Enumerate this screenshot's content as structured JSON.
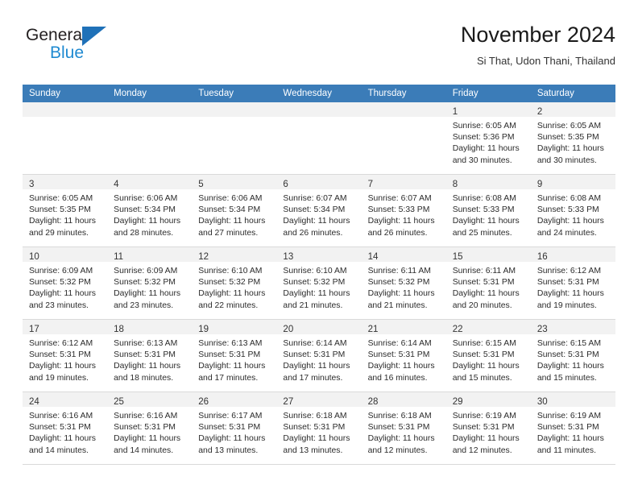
{
  "brand": {
    "name_top": "General",
    "name_bottom": "Blue",
    "accent_color": "#1f8ad1",
    "triangle_color": "#1f71b8"
  },
  "header": {
    "title": "November 2024",
    "subtitle": "Si That, Udon Thani, Thailand"
  },
  "calendar": {
    "header_bg": "#3b7cb8",
    "daynum_bg": "#f2f2f2",
    "weekdays": [
      "Sunday",
      "Monday",
      "Tuesday",
      "Wednesday",
      "Thursday",
      "Friday",
      "Saturday"
    ],
    "labels": {
      "sunrise": "Sunrise:",
      "sunset": "Sunset:",
      "daylight": "Daylight:"
    },
    "weeks": [
      [
        {
          "empty": true
        },
        {
          "empty": true
        },
        {
          "empty": true
        },
        {
          "empty": true
        },
        {
          "empty": true
        },
        {
          "day": "1",
          "sunrise": "Sunrise: 6:05 AM",
          "sunset": "Sunset: 5:36 PM",
          "daylight_1": "Daylight: 11 hours",
          "daylight_2": "and 30 minutes."
        },
        {
          "day": "2",
          "sunrise": "Sunrise: 6:05 AM",
          "sunset": "Sunset: 5:35 PM",
          "daylight_1": "Daylight: 11 hours",
          "daylight_2": "and 30 minutes."
        }
      ],
      [
        {
          "day": "3",
          "sunrise": "Sunrise: 6:05 AM",
          "sunset": "Sunset: 5:35 PM",
          "daylight_1": "Daylight: 11 hours",
          "daylight_2": "and 29 minutes."
        },
        {
          "day": "4",
          "sunrise": "Sunrise: 6:06 AM",
          "sunset": "Sunset: 5:34 PM",
          "daylight_1": "Daylight: 11 hours",
          "daylight_2": "and 28 minutes."
        },
        {
          "day": "5",
          "sunrise": "Sunrise: 6:06 AM",
          "sunset": "Sunset: 5:34 PM",
          "daylight_1": "Daylight: 11 hours",
          "daylight_2": "and 27 minutes."
        },
        {
          "day": "6",
          "sunrise": "Sunrise: 6:07 AM",
          "sunset": "Sunset: 5:34 PM",
          "daylight_1": "Daylight: 11 hours",
          "daylight_2": "and 26 minutes."
        },
        {
          "day": "7",
          "sunrise": "Sunrise: 6:07 AM",
          "sunset": "Sunset: 5:33 PM",
          "daylight_1": "Daylight: 11 hours",
          "daylight_2": "and 26 minutes."
        },
        {
          "day": "8",
          "sunrise": "Sunrise: 6:08 AM",
          "sunset": "Sunset: 5:33 PM",
          "daylight_1": "Daylight: 11 hours",
          "daylight_2": "and 25 minutes."
        },
        {
          "day": "9",
          "sunrise": "Sunrise: 6:08 AM",
          "sunset": "Sunset: 5:33 PM",
          "daylight_1": "Daylight: 11 hours",
          "daylight_2": "and 24 minutes."
        }
      ],
      [
        {
          "day": "10",
          "sunrise": "Sunrise: 6:09 AM",
          "sunset": "Sunset: 5:32 PM",
          "daylight_1": "Daylight: 11 hours",
          "daylight_2": "and 23 minutes."
        },
        {
          "day": "11",
          "sunrise": "Sunrise: 6:09 AM",
          "sunset": "Sunset: 5:32 PM",
          "daylight_1": "Daylight: 11 hours",
          "daylight_2": "and 23 minutes."
        },
        {
          "day": "12",
          "sunrise": "Sunrise: 6:10 AM",
          "sunset": "Sunset: 5:32 PM",
          "daylight_1": "Daylight: 11 hours",
          "daylight_2": "and 22 minutes."
        },
        {
          "day": "13",
          "sunrise": "Sunrise: 6:10 AM",
          "sunset": "Sunset: 5:32 PM",
          "daylight_1": "Daylight: 11 hours",
          "daylight_2": "and 21 minutes."
        },
        {
          "day": "14",
          "sunrise": "Sunrise: 6:11 AM",
          "sunset": "Sunset: 5:32 PM",
          "daylight_1": "Daylight: 11 hours",
          "daylight_2": "and 21 minutes."
        },
        {
          "day": "15",
          "sunrise": "Sunrise: 6:11 AM",
          "sunset": "Sunset: 5:31 PM",
          "daylight_1": "Daylight: 11 hours",
          "daylight_2": "and 20 minutes."
        },
        {
          "day": "16",
          "sunrise": "Sunrise: 6:12 AM",
          "sunset": "Sunset: 5:31 PM",
          "daylight_1": "Daylight: 11 hours",
          "daylight_2": "and 19 minutes."
        }
      ],
      [
        {
          "day": "17",
          "sunrise": "Sunrise: 6:12 AM",
          "sunset": "Sunset: 5:31 PM",
          "daylight_1": "Daylight: 11 hours",
          "daylight_2": "and 19 minutes."
        },
        {
          "day": "18",
          "sunrise": "Sunrise: 6:13 AM",
          "sunset": "Sunset: 5:31 PM",
          "daylight_1": "Daylight: 11 hours",
          "daylight_2": "and 18 minutes."
        },
        {
          "day": "19",
          "sunrise": "Sunrise: 6:13 AM",
          "sunset": "Sunset: 5:31 PM",
          "daylight_1": "Daylight: 11 hours",
          "daylight_2": "and 17 minutes."
        },
        {
          "day": "20",
          "sunrise": "Sunrise: 6:14 AM",
          "sunset": "Sunset: 5:31 PM",
          "daylight_1": "Daylight: 11 hours",
          "daylight_2": "and 17 minutes."
        },
        {
          "day": "21",
          "sunrise": "Sunrise: 6:14 AM",
          "sunset": "Sunset: 5:31 PM",
          "daylight_1": "Daylight: 11 hours",
          "daylight_2": "and 16 minutes."
        },
        {
          "day": "22",
          "sunrise": "Sunrise: 6:15 AM",
          "sunset": "Sunset: 5:31 PM",
          "daylight_1": "Daylight: 11 hours",
          "daylight_2": "and 15 minutes."
        },
        {
          "day": "23",
          "sunrise": "Sunrise: 6:15 AM",
          "sunset": "Sunset: 5:31 PM",
          "daylight_1": "Daylight: 11 hours",
          "daylight_2": "and 15 minutes."
        }
      ],
      [
        {
          "day": "24",
          "sunrise": "Sunrise: 6:16 AM",
          "sunset": "Sunset: 5:31 PM",
          "daylight_1": "Daylight: 11 hours",
          "daylight_2": "and 14 minutes."
        },
        {
          "day": "25",
          "sunrise": "Sunrise: 6:16 AM",
          "sunset": "Sunset: 5:31 PM",
          "daylight_1": "Daylight: 11 hours",
          "daylight_2": "and 14 minutes."
        },
        {
          "day": "26",
          "sunrise": "Sunrise: 6:17 AM",
          "sunset": "Sunset: 5:31 PM",
          "daylight_1": "Daylight: 11 hours",
          "daylight_2": "and 13 minutes."
        },
        {
          "day": "27",
          "sunrise": "Sunrise: 6:18 AM",
          "sunset": "Sunset: 5:31 PM",
          "daylight_1": "Daylight: 11 hours",
          "daylight_2": "and 13 minutes."
        },
        {
          "day": "28",
          "sunrise": "Sunrise: 6:18 AM",
          "sunset": "Sunset: 5:31 PM",
          "daylight_1": "Daylight: 11 hours",
          "daylight_2": "and 12 minutes."
        },
        {
          "day": "29",
          "sunrise": "Sunrise: 6:19 AM",
          "sunset": "Sunset: 5:31 PM",
          "daylight_1": "Daylight: 11 hours",
          "daylight_2": "and 12 minutes."
        },
        {
          "day": "30",
          "sunrise": "Sunrise: 6:19 AM",
          "sunset": "Sunset: 5:31 PM",
          "daylight_1": "Daylight: 11 hours",
          "daylight_2": "and 11 minutes."
        }
      ]
    ]
  }
}
